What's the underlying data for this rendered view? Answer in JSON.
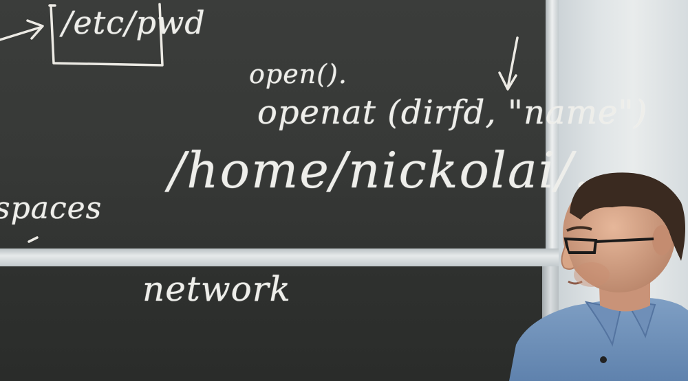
{
  "image": {
    "description": "Lecturer standing next to a chalkboard with handwritten notes",
    "chalk_text": {
      "pwd_box": "/etc/pwd",
      "open_call": "open().",
      "openat_call": "openat (dirfd, \"name\")",
      "path": "/home/nickolai/...",
      "spaces": "spaces",
      "network": "network"
    }
  }
}
